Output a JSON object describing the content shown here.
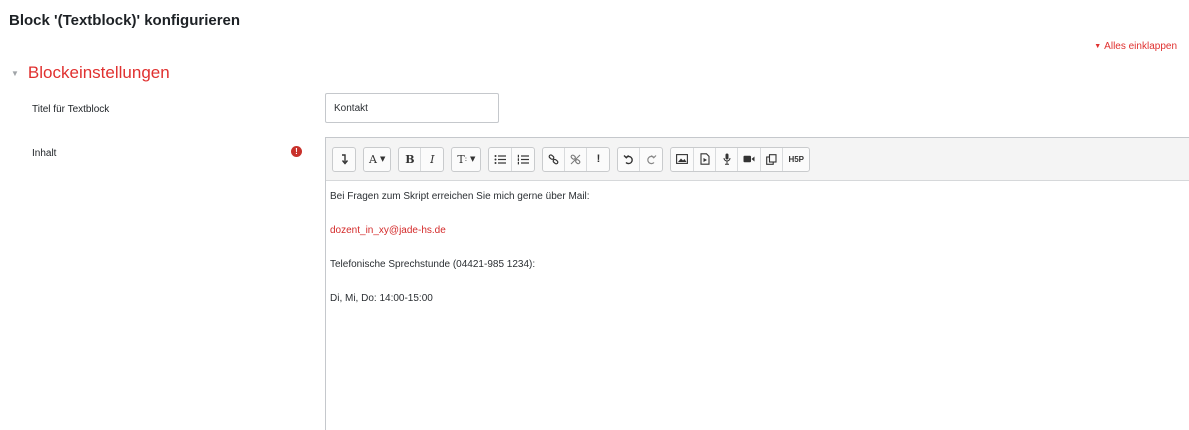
{
  "header": {
    "title": "Block '(Textblock)' konfigurieren"
  },
  "actions": {
    "collapse_all": "Alles einklappen"
  },
  "section": {
    "title": "Blockeinstellungen"
  },
  "fields": {
    "title": {
      "label": "Titel für Textblock",
      "value": "Kontakt"
    },
    "content": {
      "label": "Inhalt",
      "required_mark": "!"
    }
  },
  "toolbar": {
    "groups": [
      [
        "collapse-icon"
      ],
      [
        "font-color-icon"
      ],
      [
        "bold-icon",
        "italic-icon"
      ],
      [
        "paragraph-styles-icon"
      ],
      [
        "unordered-list-icon",
        "ordered-list-icon"
      ],
      [
        "link-icon",
        "unlink-icon",
        "emoji-icon"
      ],
      [
        "undo-icon",
        "redo-icon"
      ],
      [
        "image-icon",
        "media-icon",
        "record-audio-icon",
        "record-video-icon",
        "manage-files-icon",
        "h5p-icon"
      ]
    ],
    "labels": {
      "font_color": "A",
      "bold": "B",
      "italic": "I",
      "styles": "T",
      "emoji": "!",
      "h5p": "H5P"
    }
  },
  "editor": {
    "lines": [
      "Bei Fragen zum Skript erreichen Sie mich gerne über Mail:",
      "dozent_in_xy@jade-hs.de",
      "Telefonische Sprechstunde (04421-985 1234):",
      "Di, Mi, Do: 14:00-15:00"
    ]
  },
  "colors": {
    "accent": "#e0302f",
    "link": "#d42a2a",
    "required": "#c8312b",
    "text": "#1d2125",
    "toolbar_bg": "#f4f4f4",
    "border": "#c5c8cc"
  }
}
